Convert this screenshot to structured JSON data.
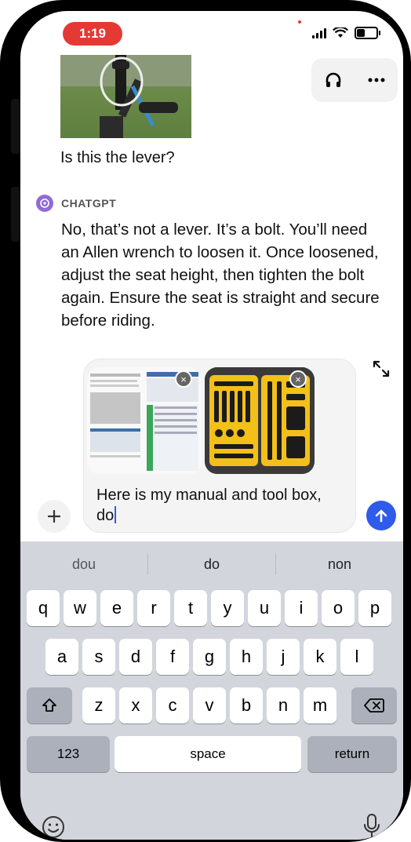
{
  "status_bar": {
    "time": "1:19"
  },
  "header": {
    "headphones_icon": "headphones-icon",
    "more_icon": "more-icon"
  },
  "chat": {
    "user_message": "Is this the lever?",
    "assistant_name": "CHATGPT",
    "assistant_message": "No, that’s not a lever. It’s a bolt. You’ll need an Allen wrench to loosen it. Once loosened, adjust the seat height, then tighten the bolt again. Ensure the seat is straight and secure before riding."
  },
  "composer": {
    "text": "Here is my manual and tool box, do",
    "attachments": [
      {
        "name": "manual-screenshot"
      },
      {
        "name": "toolbox-photo"
      }
    ],
    "remove_label": "×",
    "plus_label": "+"
  },
  "keyboard": {
    "suggestions": [
      "dou",
      "do",
      "non"
    ],
    "row1": [
      "q",
      "w",
      "e",
      "r",
      "t",
      "y",
      "u",
      "i",
      "o",
      "p"
    ],
    "row2": [
      "a",
      "s",
      "d",
      "f",
      "g",
      "h",
      "j",
      "k",
      "l"
    ],
    "row3": [
      "z",
      "x",
      "c",
      "v",
      "b",
      "n",
      "m"
    ],
    "numbers_label": "123",
    "space_label": "space",
    "return_label": "return"
  },
  "colors": {
    "accent": "#2f5bea",
    "time_pill": "#e53935",
    "keyboard_bg": "#d2d5dc"
  }
}
